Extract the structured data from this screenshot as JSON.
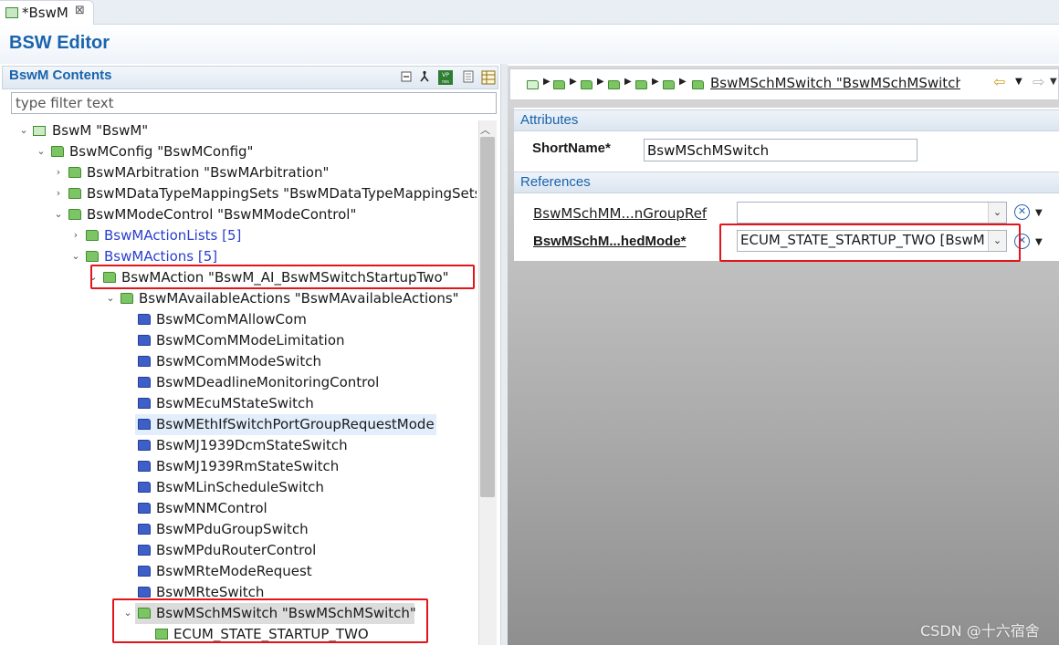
{
  "editor_tab": {
    "label": "*BswM",
    "close": "⊠"
  },
  "editor_title": "BSW Editor",
  "left_panel": {
    "title": "BswM Contents",
    "filter_placeholder": "type filter text",
    "tree": [
      {
        "label": "BswM \"BswM\"",
        "twisty": "⌄",
        "icon": "root-module"
      },
      {
        "label": "BswMConfig \"BswMConfig\"",
        "twisty": "⌄",
        "icon": "green-folder"
      },
      {
        "label": "BswMArbitration \"BswMArbitration\"",
        "twisty": "›",
        "icon": "green-folder"
      },
      {
        "label": "BswMDataTypeMappingSets \"BswMDataTypeMappingSets\"",
        "twisty": "›",
        "icon": "green-folder"
      },
      {
        "label": "BswMModeControl \"BswMModeControl\"",
        "twisty": "⌄",
        "icon": "green-folder"
      },
      {
        "label": "BswMActionLists [5]",
        "twisty": "›",
        "icon": "green-folder"
      },
      {
        "label": "BswMActions [5]",
        "twisty": "⌄",
        "icon": "green-folder"
      },
      {
        "label": "BswMAction \"BswM_AI_BswMSwitchStartupTwo\"",
        "twisty": "⌄",
        "icon": "green-folder"
      },
      {
        "label": "BswMAvailableActions \"BswMAvailableActions\"",
        "twisty": "⌄",
        "icon": "green-folder"
      },
      {
        "label": "BswMComMAllowCom",
        "icon": "blue-folder"
      },
      {
        "label": "BswMComMModeLimitation",
        "icon": "blue-folder"
      },
      {
        "label": "BswMComMModeSwitch",
        "icon": "blue-folder"
      },
      {
        "label": "BswMDeadlineMonitoringControl",
        "icon": "blue-folder"
      },
      {
        "label": "BswMEcuMStateSwitch",
        "icon": "blue-folder"
      },
      {
        "label": "BswMEthIfSwitchPortGroupRequestMode",
        "icon": "blue-folder"
      },
      {
        "label": "BswMJ1939DcmStateSwitch",
        "icon": "blue-folder"
      },
      {
        "label": "BswMJ1939RmStateSwitch",
        "icon": "blue-folder"
      },
      {
        "label": "BswMLinScheduleSwitch",
        "icon": "blue-folder"
      },
      {
        "label": "BswMNMControl",
        "icon": "blue-folder"
      },
      {
        "label": "BswMPduGroupSwitch",
        "icon": "blue-folder"
      },
      {
        "label": "BswMPduRouterControl",
        "icon": "blue-folder"
      },
      {
        "label": "BswMRteModeRequest",
        "icon": "blue-folder"
      },
      {
        "label": "BswMRteSwitch",
        "icon": "blue-folder"
      },
      {
        "label": "BswMSchMSwitch \"BswMSchMSwitch\"",
        "twisty": "⌄",
        "icon": "green-folder"
      },
      {
        "label": "ECUM_STATE_STARTUP_TWO",
        "icon": "reference"
      }
    ]
  },
  "breadcrumb": {
    "current": "BswMSchMSwitch \"BswMSchMSwitch\"",
    "back": "⇦",
    "forward": "⇨",
    "dropdown": "▼"
  },
  "attributes": {
    "title": "Attributes",
    "shortname_label": "ShortName*",
    "shortname_value": "BswMSchMSwitch"
  },
  "references": {
    "title": "References",
    "rows": [
      {
        "label": "BswMSchMM...nGroupRef",
        "value": ""
      },
      {
        "label": "BswMSchM...hedMode*",
        "value": "ECUM_STATE_STARTUP_TWO [BswM"
      }
    ]
  },
  "watermark": "CSDN @十六宿舍",
  "colors": {
    "accent": "#1a63ad",
    "annotation_red": "#e3141a",
    "link": "#2a3fcc"
  }
}
